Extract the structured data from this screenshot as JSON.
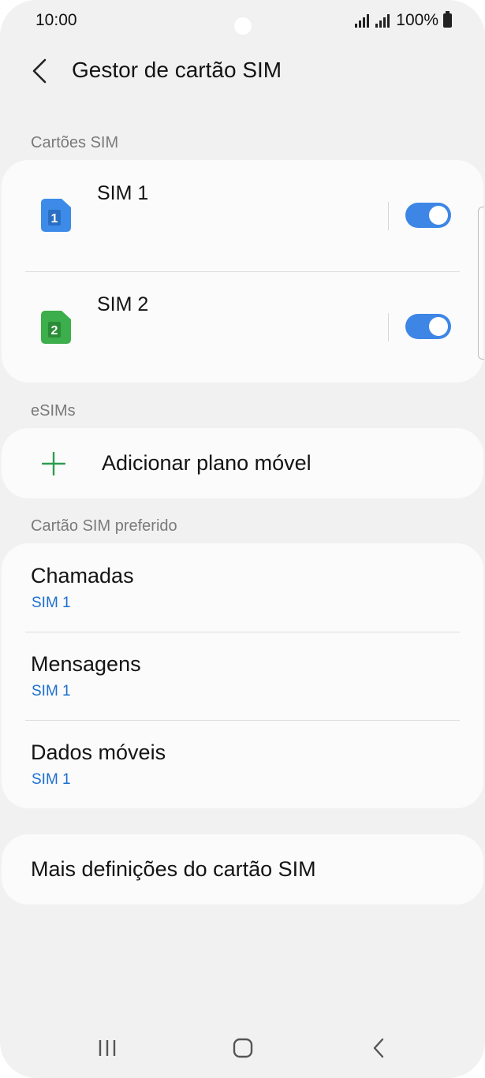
{
  "status_bar": {
    "time": "10:00",
    "battery": "100%"
  },
  "header": {
    "title": "Gestor de cartão SIM",
    "back_icon": "chevron-left-icon"
  },
  "sections": {
    "sim_cards": "Cartões SIM",
    "esims": "eSIMs",
    "preferred": "Cartão SIM preferido"
  },
  "sim_cards": [
    {
      "name": "SIM 1",
      "badge": "1",
      "color": "#3d8be8",
      "enabled": true
    },
    {
      "name": "SIM 2",
      "badge": "2",
      "color": "#3cae4b",
      "enabled": true
    }
  ],
  "esim": {
    "add_label": "Adicionar plano móvel",
    "plus_color": "#2e9c4f"
  },
  "preferred": [
    {
      "title": "Chamadas",
      "value": "SIM 1"
    },
    {
      "title": "Mensagens",
      "value": "SIM 1"
    },
    {
      "title": "Dados móveis",
      "value": "SIM 1"
    }
  ],
  "more_settings": "Mais definições do cartão SIM",
  "colors": {
    "accent": "#3d86e6",
    "link": "#1c6fd0",
    "background": "#f1f1f1",
    "card": "#fbfbfb"
  },
  "nav": {
    "recents": "recents-icon",
    "home": "home-icon",
    "back": "back-icon"
  }
}
